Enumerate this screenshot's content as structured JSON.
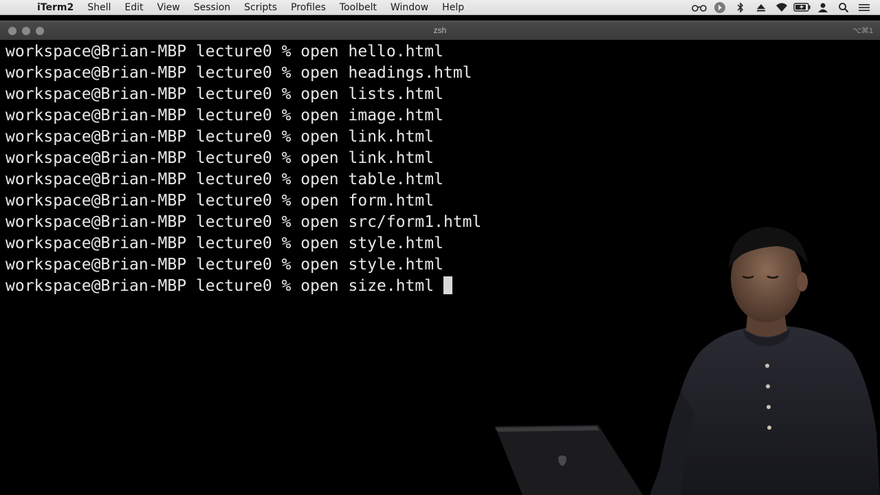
{
  "menubar": {
    "app_name": "iTerm2",
    "items": [
      "Shell",
      "Edit",
      "View",
      "Session",
      "Scripts",
      "Profiles",
      "Toolbelt",
      "Window",
      "Help"
    ],
    "status_icons": [
      "glasses-icon",
      "record-icon",
      "bluetooth-icon",
      "eject-icon",
      "wifi-icon",
      "battery-icon",
      "user-icon",
      "search-icon",
      "list-icon"
    ]
  },
  "window": {
    "title": "zsh",
    "shortcut": "⌥⌘1"
  },
  "terminal": {
    "prompt": "workspace@Brian-MBP lecture0 % ",
    "lines": [
      "open hello.html",
      "open headings.html",
      "open lists.html",
      "open image.html",
      "open link.html",
      "open link.html",
      "open table.html",
      "open form.html",
      "open src/form1.html",
      "open style.html",
      "open style.html",
      "open size.html"
    ]
  },
  "colors": {
    "terminal_bg": "#000000",
    "terminal_fg": "#e8e8e8",
    "menubar_bg": "#e6e6e6",
    "titlebar_bg": "#3f3f3f"
  }
}
